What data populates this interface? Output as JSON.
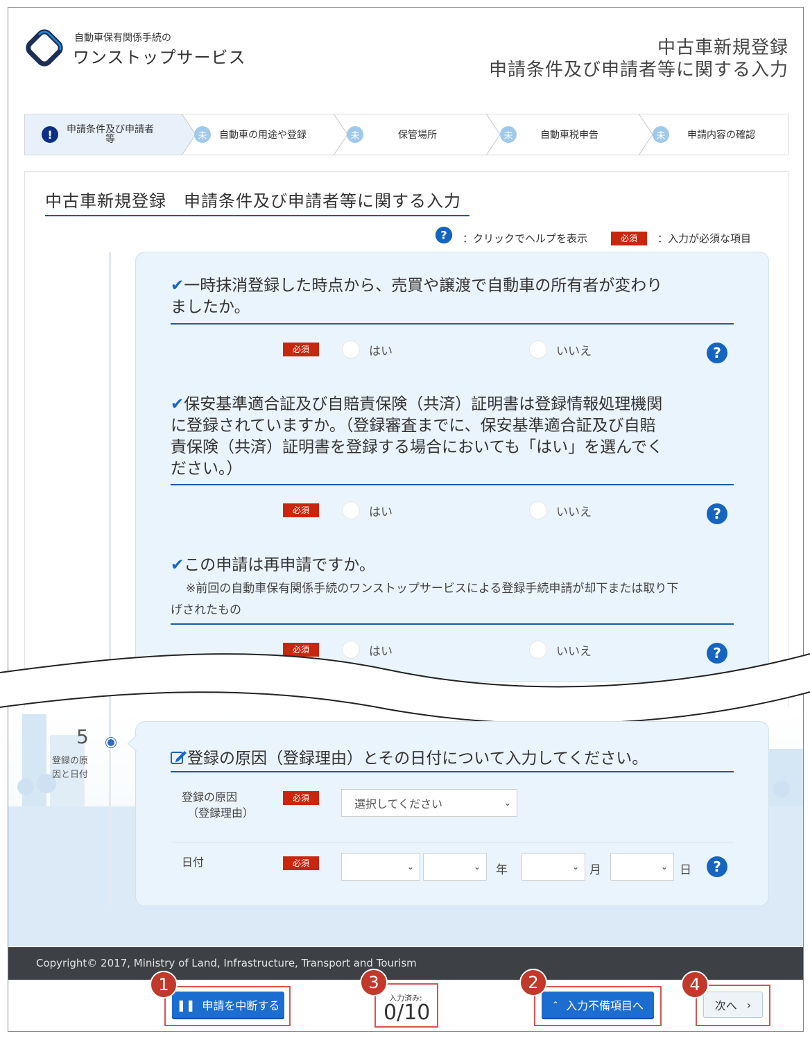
{
  "header": {
    "brand_small": "自動車保有関係手続の",
    "brand_big": "ワンストップサービス",
    "title_line1": "中古車新規登録",
    "title_line2": "申請条件及び申請者等に関する入力"
  },
  "stepper": {
    "steps": [
      {
        "icon": "!",
        "label": "申請条件及び申請者等",
        "label_line1": "申請条件及び申請者",
        "label_line2": "等",
        "state": "current"
      },
      {
        "icon": "未",
        "label": "自動車の用途や登録",
        "state": "pending"
      },
      {
        "icon": "未",
        "label": "保管場所",
        "state": "pending"
      },
      {
        "icon": "未",
        "label": "自動車税申告",
        "state": "pending"
      },
      {
        "icon": "未",
        "label": "申請内容の確認",
        "state": "pending"
      }
    ]
  },
  "section": {
    "title": "中古車新規登録　申請条件及び申請者等に関する入力",
    "legend_help": "：クリックでヘルプを表示",
    "legend_required_badge": "必須",
    "legend_required": "：入力が必須な項目"
  },
  "questions": [
    {
      "check": "✔",
      "text_line1": "一時抹消登録した時点から、売買や譲渡で自動車の所有者が変わり",
      "text_line2": "ましたか。",
      "required": "必須",
      "yes": "はい",
      "no": "いいえ"
    },
    {
      "check": "✔",
      "text_line1": "保安基準適合証及び自賠責保険（共済）証明書は登録情報処理機関",
      "text_line2": "に登録されていますか。（登録審査までに、保安基準適合証及び自賠",
      "text_line3": "責保険（共済）証明書を登録する場合においても「はい」を選んでく",
      "text_line4": "ださい。）",
      "required": "必須",
      "yes": "はい",
      "no": "いいえ"
    },
    {
      "check": "✔",
      "text_line1": "この申請は再申請ですか。",
      "note_line1": "※前回の自動車保有関係手続のワンストップサービスによる登録手続申請が却下または取り下",
      "note_line2": "げされたもの",
      "required": "必須",
      "yes": "はい",
      "no": "いいえ"
    }
  ],
  "step5": {
    "number": "5",
    "label_line1": "登録の原",
    "label_line2": "因と日付",
    "title": "登録の原因（登録理由）とその日付について入力してください。",
    "reason_label_line1": "登録の原因",
    "reason_label_line2": "（登録理由）",
    "reason_required": "必須",
    "reason_select": "選択してください",
    "date_label": "日付",
    "date_required": "必須",
    "year_unit": "年",
    "month_unit": "月",
    "day_unit": "日"
  },
  "footer": {
    "copyright": "Copyright© 2017, Ministry of Land, Infrastructure, Transport and Tourism",
    "suspend_button": "申請を中断する",
    "count_label": "入力済み:",
    "count_value": "0/10",
    "incomplete_button": "入力不備項目へ",
    "next_button": "次へ",
    "callouts": [
      "1",
      "2",
      "3",
      "4"
    ]
  },
  "colors": {
    "accent": "#1a5aa6",
    "button": "#1c6dd0",
    "required": "#c9260e",
    "panel": "#eaf4fc",
    "callout": "#c0392b",
    "footer_bar": "#3d4045"
  }
}
